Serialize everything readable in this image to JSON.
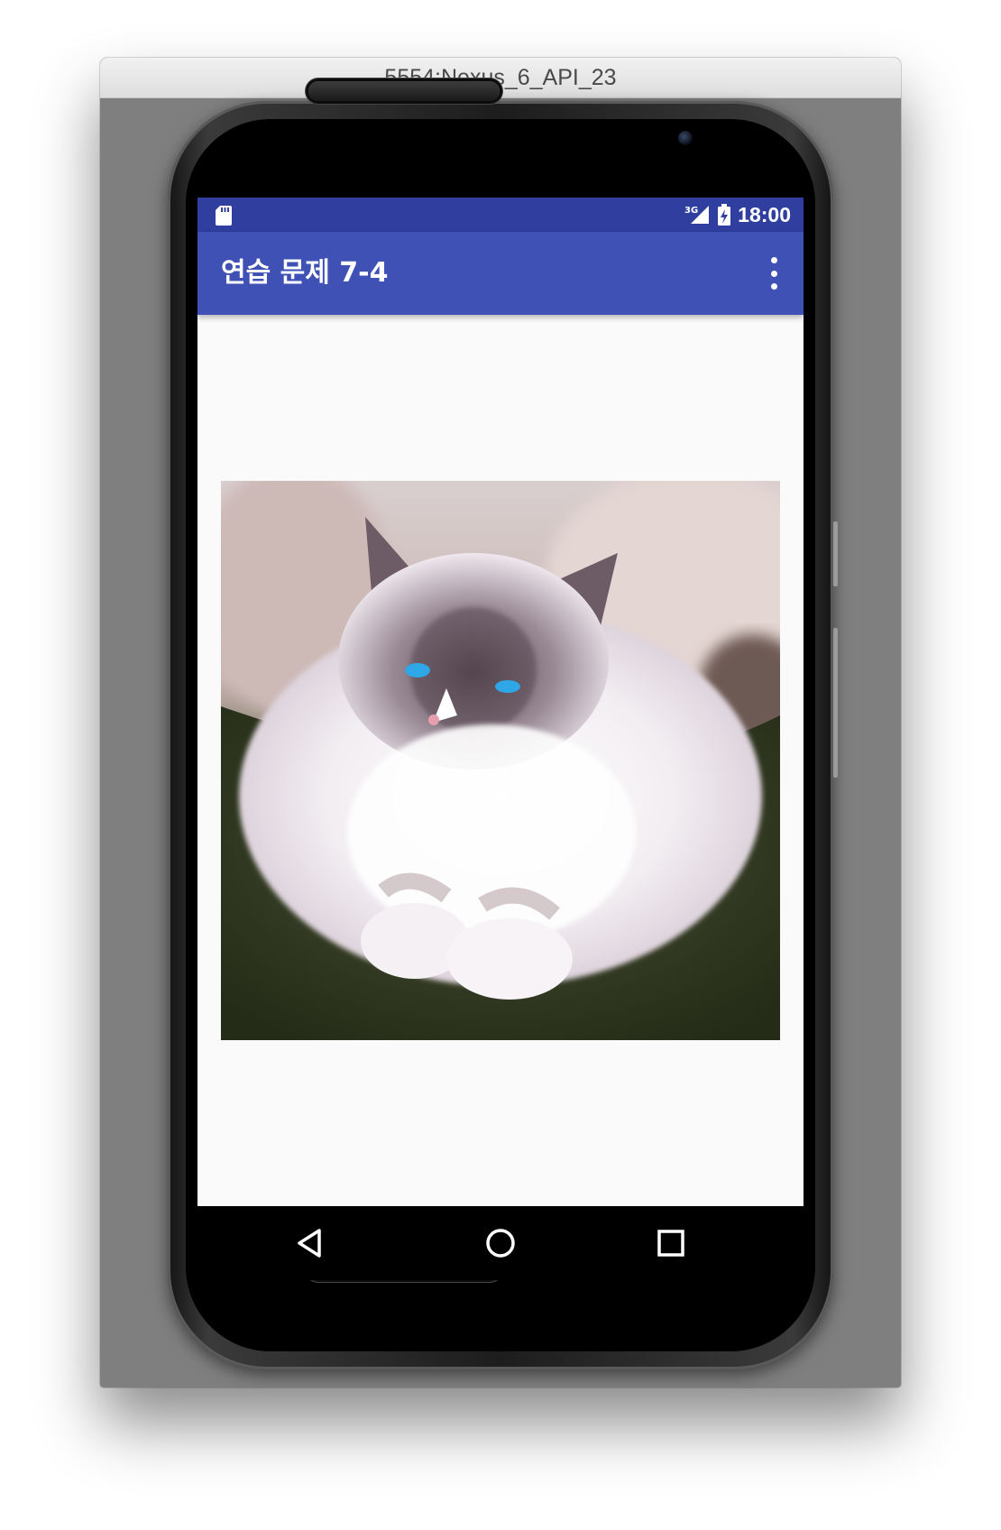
{
  "window": {
    "title": "5554:Nexus_6_API_23"
  },
  "status_bar": {
    "network": "3G",
    "time": "18:00",
    "color": "#303f9f"
  },
  "app_bar": {
    "title": "연습 문제 7-4",
    "color": "#3f51b5"
  },
  "content": {
    "image_icon": "cat-photo"
  },
  "navigation": {
    "back_icon": "triangle-back-icon",
    "home_icon": "circle-home-icon",
    "recents_icon": "square-recents-icon"
  }
}
